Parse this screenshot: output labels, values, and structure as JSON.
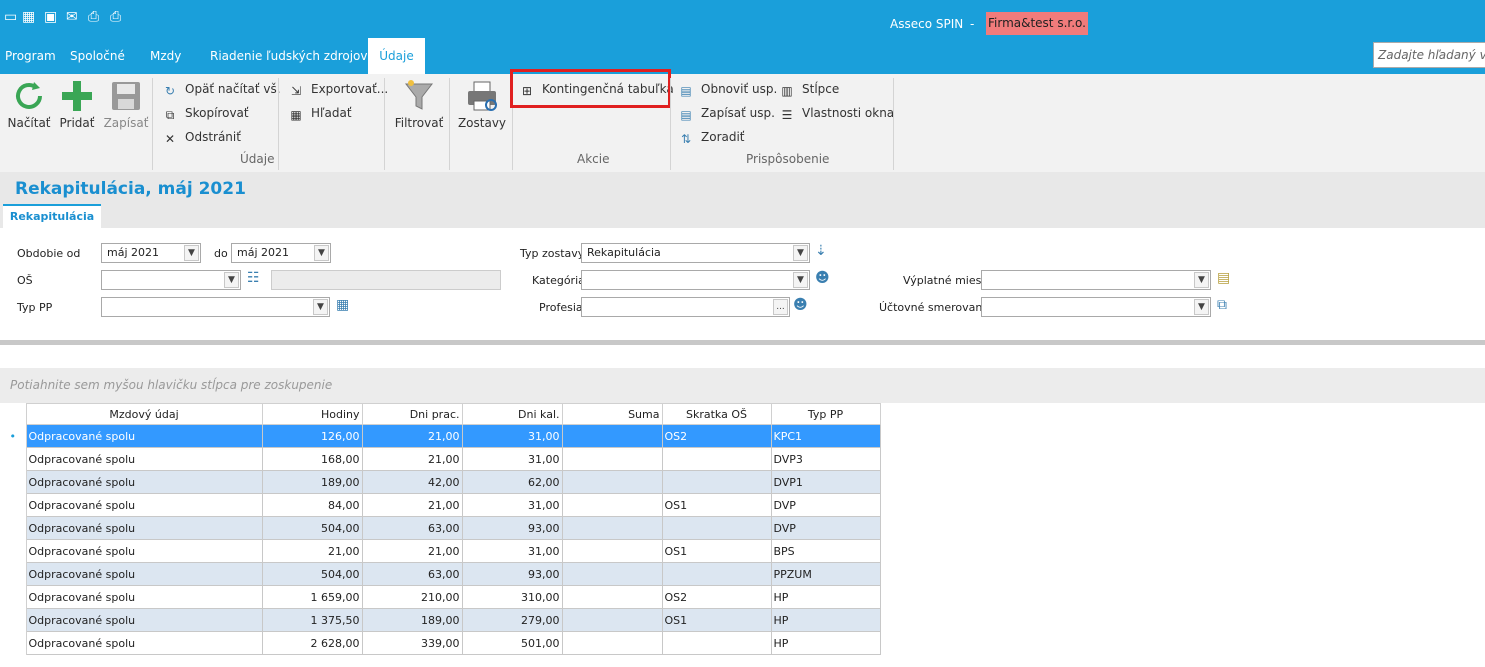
{
  "app": {
    "name": "Asseco SPIN",
    "dash": "-",
    "company": "Firma&test s.r.o."
  },
  "menu": {
    "items": [
      "Program",
      "Spoločné",
      "Mzdy",
      "Riadenie ľudských zdrojov"
    ],
    "active": "Údaje",
    "search_placeholder": "Zadajte hľadaný výraz"
  },
  "ribbon": {
    "big": {
      "load": "Načítať",
      "add": "Pridať",
      "save": "Zapísať",
      "filter": "Filtrovať",
      "reports": "Zostavy"
    },
    "data_group": {
      "reload_all": "Opäť načítať vš.",
      "copy": "Skopírovať",
      "delete": "Odstrániť",
      "export": "Exportovať...",
      "find": "Hľadať",
      "label": "Údaje"
    },
    "actions_group": {
      "pivot": "Kontingenčná tabuľka",
      "label": "Akcie"
    },
    "custom_group": {
      "restore": "Obnoviť usp.",
      "save_layout": "Zapísať usp.",
      "sort": "Zoradiť",
      "columns": "Stĺpce",
      "window_props": "Vlastnosti okna",
      "label": "Prispôsobenie"
    }
  },
  "document": {
    "title": "Rekapitulácia, máj 2021",
    "tab": "Rekapitulácia"
  },
  "filters": {
    "period_from_label": "Obdobie od",
    "period_from": "máj 2021",
    "to_label": "do",
    "period_to": "máj 2021",
    "os_label": "OŠ",
    "os_value": "",
    "pp_type_label": "Typ PP",
    "pp_type_value": "",
    "report_type_label": "Typ zostavy",
    "report_type": "Rekapitulácia",
    "category_label": "Kategória",
    "category_value": "",
    "profession_label": "Profesia",
    "profession_value": "",
    "pay_place_label": "Výplatné miesto",
    "pay_place_value": "",
    "accounting_label": "Účtovné smerovanie",
    "accounting_value": "",
    "ellipsis": "..."
  },
  "grid": {
    "group_hint": "Potiahnite sem myšou hlavičku stĺpca pre zoskupenie",
    "columns": [
      "Mzdový údaj",
      "Hodiny",
      "Dni prac.",
      "Dni kal.",
      "Suma",
      "Skratka OŠ",
      "Typ PP"
    ],
    "rows": [
      [
        "Odpracované spolu",
        "126,00",
        "21,00",
        "31,00",
        "",
        "OS2",
        "KPC1"
      ],
      [
        "Odpracované spolu",
        "168,00",
        "21,00",
        "31,00",
        "",
        "",
        "DVP3"
      ],
      [
        "Odpracované spolu",
        "189,00",
        "42,00",
        "62,00",
        "",
        "",
        "DVP1"
      ],
      [
        "Odpracované spolu",
        "84,00",
        "21,00",
        "31,00",
        "",
        "OS1",
        "DVP"
      ],
      [
        "Odpracované spolu",
        "504,00",
        "63,00",
        "93,00",
        "",
        "",
        "DVP"
      ],
      [
        "Odpracované spolu",
        "21,00",
        "21,00",
        "31,00",
        "",
        "OS1",
        "BPS"
      ],
      [
        "Odpracované spolu",
        "504,00",
        "63,00",
        "93,00",
        "",
        "",
        "PPZUM"
      ],
      [
        "Odpracované spolu",
        "1 659,00",
        "210,00",
        "310,00",
        "",
        "OS2",
        "HP"
      ],
      [
        "Odpracované spolu",
        "1 375,50",
        "189,00",
        "279,00",
        "",
        "OS1",
        "HP"
      ],
      [
        "Odpracované spolu",
        "2 628,00",
        "339,00",
        "501,00",
        "",
        "",
        "HP"
      ]
    ],
    "selected_row": 0,
    "row_indicator": "•"
  }
}
